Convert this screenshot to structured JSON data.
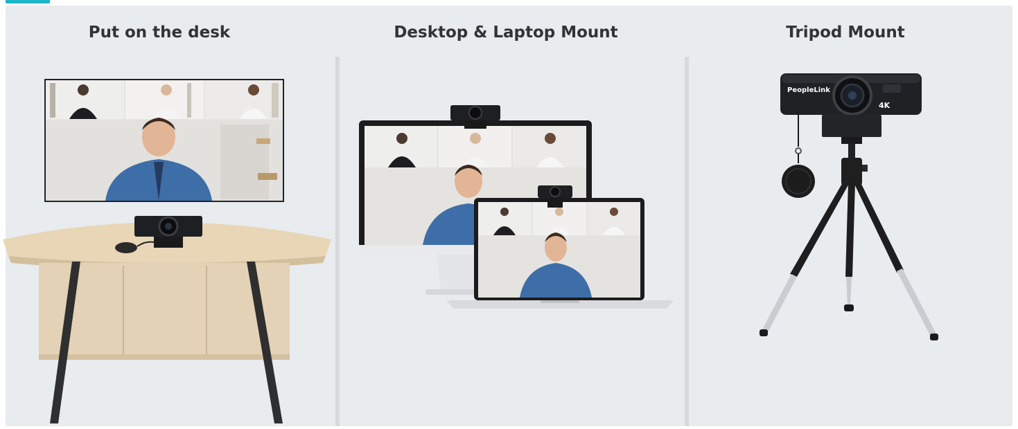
{
  "columns": [
    {
      "title": "Put on the desk"
    },
    {
      "title": "Desktop & Laptop Mount"
    },
    {
      "title": "Tripod Mount"
    }
  ],
  "camera": {
    "brand": "PeopleLink",
    "badge": "4K"
  },
  "colors": {
    "background": "#e8ecef",
    "divider": "#d6dadd",
    "title_text": "#333333",
    "accent": "#1cb4c9"
  }
}
